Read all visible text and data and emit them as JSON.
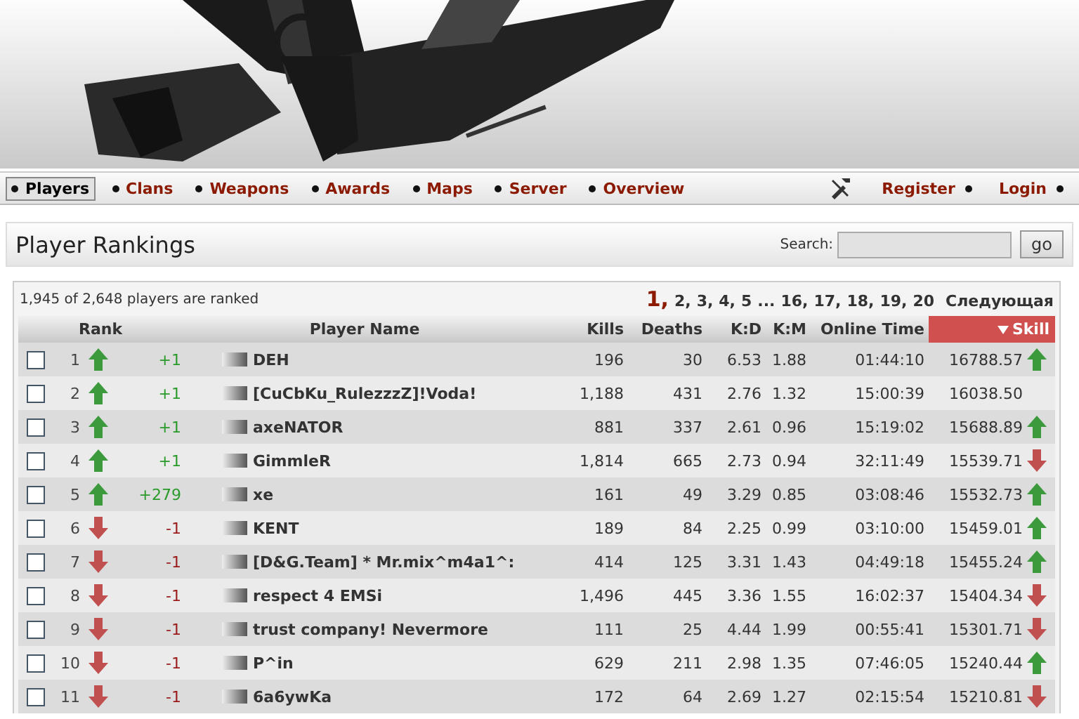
{
  "nav": {
    "items": [
      {
        "label": "Players",
        "selected": true
      },
      {
        "label": "Clans",
        "selected": false
      },
      {
        "label": "Weapons",
        "selected": false
      },
      {
        "label": "Awards",
        "selected": false
      },
      {
        "label": "Maps",
        "selected": false
      },
      {
        "label": "Server",
        "selected": false
      },
      {
        "label": "Overview",
        "selected": false
      }
    ],
    "account": [
      "Register",
      "Login"
    ]
  },
  "panel": {
    "title": "Player Rankings",
    "search": {
      "label": "Search:",
      "button": "go"
    }
  },
  "summary": "1,945 of 2,648 players are ranked",
  "pagination": {
    "pages": [
      {
        "label": "1,",
        "selected": true
      },
      {
        "label": "2,",
        "selected": false
      },
      {
        "label": "3,",
        "selected": false
      },
      {
        "label": "4,",
        "selected": false
      },
      {
        "label": "5",
        "selected": false
      },
      {
        "label": "...",
        "selected": false
      },
      {
        "label": "16,",
        "selected": false
      },
      {
        "label": "17,",
        "selected": false
      },
      {
        "label": "18,",
        "selected": false
      },
      {
        "label": "19,",
        "selected": false
      },
      {
        "label": "20",
        "selected": false
      }
    ],
    "next": "Следующая"
  },
  "table": {
    "columns": [
      {
        "label": "Rank",
        "sorted": false
      },
      {
        "label": "Player Name",
        "sorted": false
      },
      {
        "label": "Kills",
        "sorted": false
      },
      {
        "label": "Deaths",
        "sorted": false
      },
      {
        "label": "K:D",
        "sorted": false
      },
      {
        "label": "K:M",
        "sorted": false
      },
      {
        "label": "Online Time",
        "sorted": false
      },
      {
        "label": "Skill",
        "sorted": true
      }
    ],
    "rows": [
      {
        "checked": false,
        "rank": "1",
        "rank_arrow": {
          "kind": "up"
        },
        "change": "+1",
        "name": "DEH",
        "kills": "196",
        "deaths": "30",
        "kd": "6.53",
        "km": "1.88",
        "time": "01:44:10",
        "skill": "16788.57",
        "skill_arrow": {
          "kind": "up"
        }
      },
      {
        "checked": false,
        "rank": "2",
        "rank_arrow": {
          "kind": "up"
        },
        "change": "+1",
        "name": "[CuCbKu_RulezzzZ]!Voda!",
        "kills": "1,188",
        "deaths": "431",
        "kd": "2.76",
        "km": "1.32",
        "time": "15:00:39",
        "skill": "16038.50"
      },
      {
        "checked": false,
        "rank": "3",
        "rank_arrow": {
          "kind": "up"
        },
        "change": "+1",
        "name": "axeNATOR",
        "kills": "881",
        "deaths": "337",
        "kd": "2.61",
        "km": "0.96",
        "time": "15:19:02",
        "skill": "15688.89",
        "skill_arrow": {
          "kind": "up"
        }
      },
      {
        "checked": false,
        "rank": "4",
        "rank_arrow": {
          "kind": "up"
        },
        "change": "+1",
        "name": "GimmleR",
        "kills": "1,814",
        "deaths": "665",
        "kd": "2.73",
        "km": "0.94",
        "time": "32:11:49",
        "skill": "15539.71",
        "skill_arrow": {
          "kind": "down"
        }
      },
      {
        "checked": false,
        "rank": "5",
        "rank_arrow": {
          "kind": "up"
        },
        "change": "+279",
        "name": "xe",
        "kills": "161",
        "deaths": "49",
        "kd": "3.29",
        "km": "0.85",
        "time": "03:08:46",
        "skill": "15532.73",
        "skill_arrow": {
          "kind": "up"
        }
      },
      {
        "checked": false,
        "rank": "6",
        "rank_arrow": {
          "kind": "down"
        },
        "change": "-1",
        "name": "KENT",
        "kills": "189",
        "deaths": "84",
        "kd": "2.25",
        "km": "0.99",
        "time": "03:10:00",
        "skill": "15459.01",
        "skill_arrow": {
          "kind": "up"
        }
      },
      {
        "checked": false,
        "rank": "7",
        "rank_arrow": {
          "kind": "down"
        },
        "change": "-1",
        "name": "[D&G.Team] * Mr.mix^m4a1^:",
        "kills": "414",
        "deaths": "125",
        "kd": "3.31",
        "km": "1.43",
        "time": "04:49:18",
        "skill": "15455.24",
        "skill_arrow": {
          "kind": "up"
        }
      },
      {
        "checked": false,
        "rank": "8",
        "rank_arrow": {
          "kind": "down"
        },
        "change": "-1",
        "name": "respect 4 EMSi",
        "kills": "1,496",
        "deaths": "445",
        "kd": "3.36",
        "km": "1.55",
        "time": "16:02:37",
        "skill": "15404.34",
        "skill_arrow": {
          "kind": "down"
        }
      },
      {
        "checked": false,
        "rank": "9",
        "rank_arrow": {
          "kind": "down"
        },
        "change": "-1",
        "name": "trust company! Nevermore",
        "kills": "111",
        "deaths": "25",
        "kd": "4.44",
        "km": "1.99",
        "time": "00:55:41",
        "skill": "15301.71",
        "skill_arrow": {
          "kind": "down"
        }
      },
      {
        "checked": false,
        "rank": "10",
        "rank_arrow": {
          "kind": "down"
        },
        "change": "-1",
        "name": "P^in",
        "kills": "629",
        "deaths": "211",
        "kd": "2.98",
        "km": "1.35",
        "time": "07:46:05",
        "skill": "15240.44",
        "skill_arrow": {
          "kind": "up"
        }
      },
      {
        "checked": false,
        "rank": "11",
        "rank_arrow": {
          "kind": "down"
        },
        "change": "-1",
        "name": "6a6ywKa",
        "kills": "172",
        "deaths": "64",
        "kd": "2.69",
        "km": "1.27",
        "time": "02:15:54",
        "skill": "15210.81",
        "skill_arrow": {
          "kind": "down"
        }
      }
    ]
  }
}
